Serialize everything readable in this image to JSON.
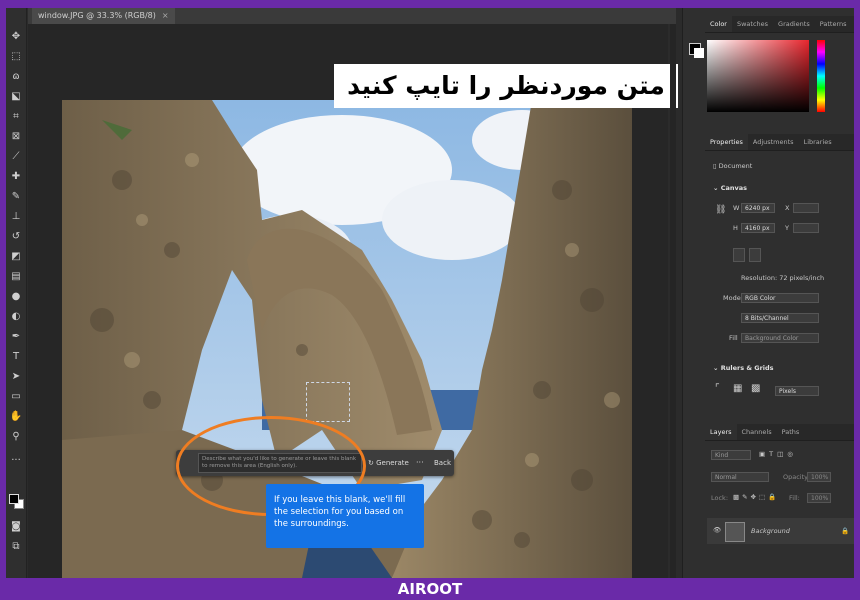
{
  "document": {
    "tab_title": "window.JPG @ 33.3% (RGB/8)",
    "close_glyph": "×"
  },
  "banner": {
    "text": "متن موردنظر را تایپ کنید"
  },
  "task_bar": {
    "prompt_placeholder": "Describe what you'd like to generate or leave this blank to remove this area (English only).",
    "generate_label": "Generate",
    "more_label": "···",
    "back_label": "Back"
  },
  "tooltip": {
    "text": "If you leave this blank, we'll fill the selection for you based on the surroundings."
  },
  "color_panel": {
    "tabs": [
      "Color",
      "Swatches",
      "Gradients",
      "Patterns"
    ]
  },
  "properties_panel": {
    "tabs": [
      "Properties",
      "Adjustments",
      "Libraries"
    ],
    "document_label": "Document",
    "canvas_section": "Canvas",
    "width_label": "W",
    "width_value": "6240 px",
    "height_label": "H",
    "height_value": "4160 px",
    "x_label": "X",
    "y_label": "Y",
    "resolution": "Resolution: 72 pixels/inch",
    "mode_label": "Mode",
    "mode_value": "RGB Color",
    "depth_value": "8 Bits/Channel",
    "fill_label": "Fill",
    "fill_value": "Background Color",
    "rulers_section": "Rulers & Grids",
    "units_value": "Pixels"
  },
  "layers_panel": {
    "tabs": [
      "Layers",
      "Channels",
      "Paths"
    ],
    "kind_label": "Kind",
    "blend_label": "Normal",
    "opacity_label": "Opacity:",
    "opacity_value": "100%",
    "lock_label": "Lock:",
    "fill_label": "Fill:",
    "fill_value": "100%",
    "layer_name": "Background"
  },
  "watermark": {
    "text": "AIROOT"
  },
  "colors": {
    "accent": "#6a2aa8",
    "orange_highlight": "#ef7d22",
    "tooltip_blue": "#1473e6"
  },
  "icons": [
    "move-icon",
    "marquee-icon",
    "lasso-icon",
    "object-select-icon",
    "crop-icon",
    "frame-icon",
    "eyedropper-icon",
    "healing-icon",
    "brush-icon",
    "stamp-icon",
    "history-brush-icon",
    "eraser-icon",
    "gradient-icon",
    "blur-icon",
    "dodge-icon",
    "pen-icon",
    "type-icon",
    "path-select-icon",
    "rectangle-icon",
    "hand-icon",
    "zoom-icon",
    "more-tools-icon"
  ]
}
